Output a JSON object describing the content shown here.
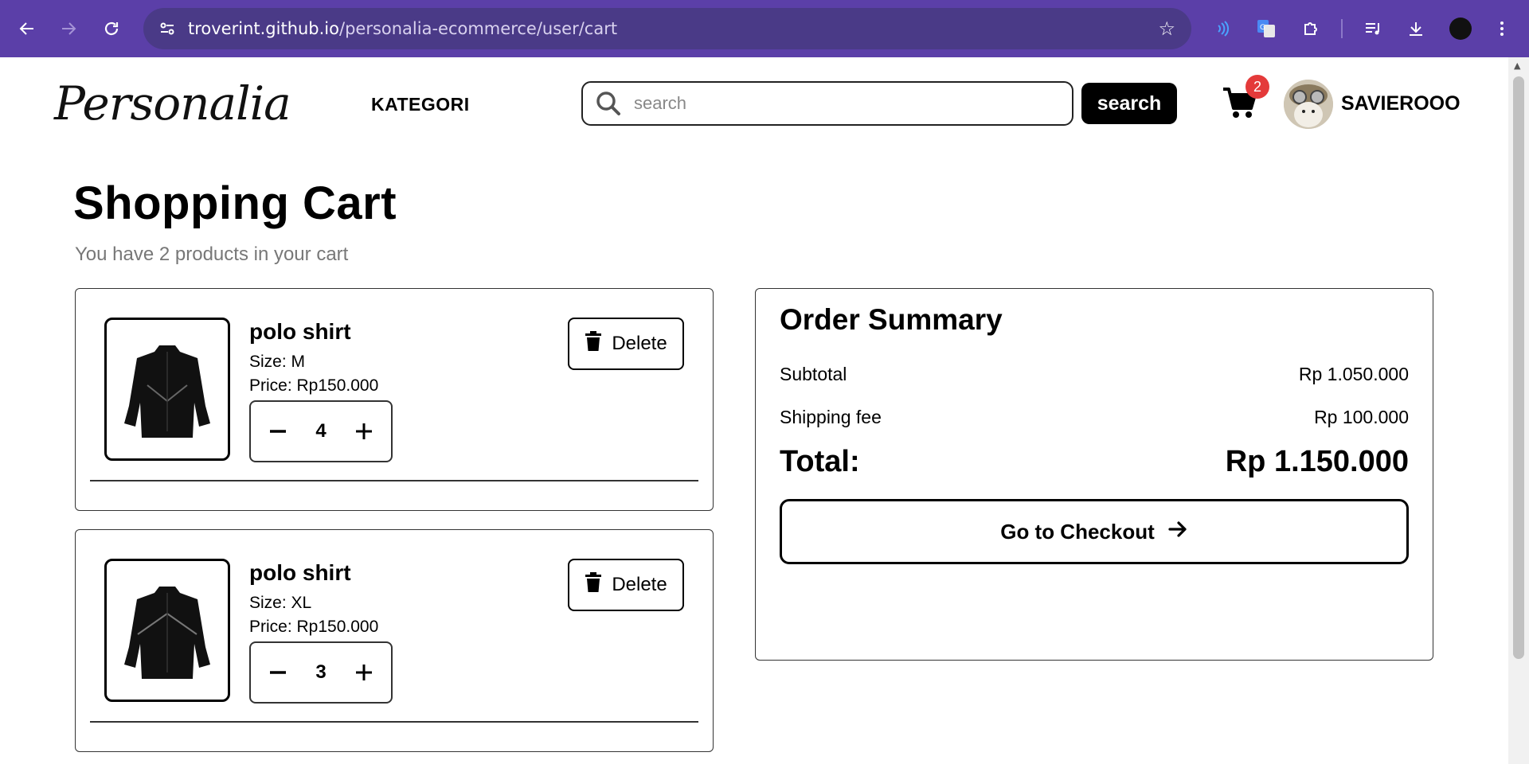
{
  "browser": {
    "url_host": "troverint.github.io",
    "url_path": "/personalia-ecommerce/user/cart"
  },
  "header": {
    "logo": "Personalia",
    "nav_kategori": "KATEGORI",
    "search_placeholder": "search",
    "search_button": "search",
    "cart_count": "2",
    "username": "SAVIEROOO"
  },
  "cart": {
    "title": "Shopping Cart",
    "subtitle": "You have 2 products in your cart",
    "items": [
      {
        "name": "polo shirt",
        "size": "Size: M",
        "price": "Price: Rp150.000",
        "quantity": "4",
        "delete_label": "Delete"
      },
      {
        "name": "polo shirt",
        "size": "Size: XL",
        "price": "Price: Rp150.000",
        "quantity": "3",
        "delete_label": "Delete"
      }
    ]
  },
  "summary": {
    "title": "Order Summary",
    "subtotal_label": "Subtotal",
    "subtotal_value": "Rp 1.050.000",
    "shipping_label": "Shipping fee",
    "shipping_value": "Rp 100.000",
    "total_label": "Total:",
    "total_value": "Rp 1.150.000",
    "checkout_label": "Go to Checkout"
  },
  "colors": {
    "browser_frame": "#5b3fa8",
    "badge": "#e43a3a",
    "primary": "#000000"
  }
}
